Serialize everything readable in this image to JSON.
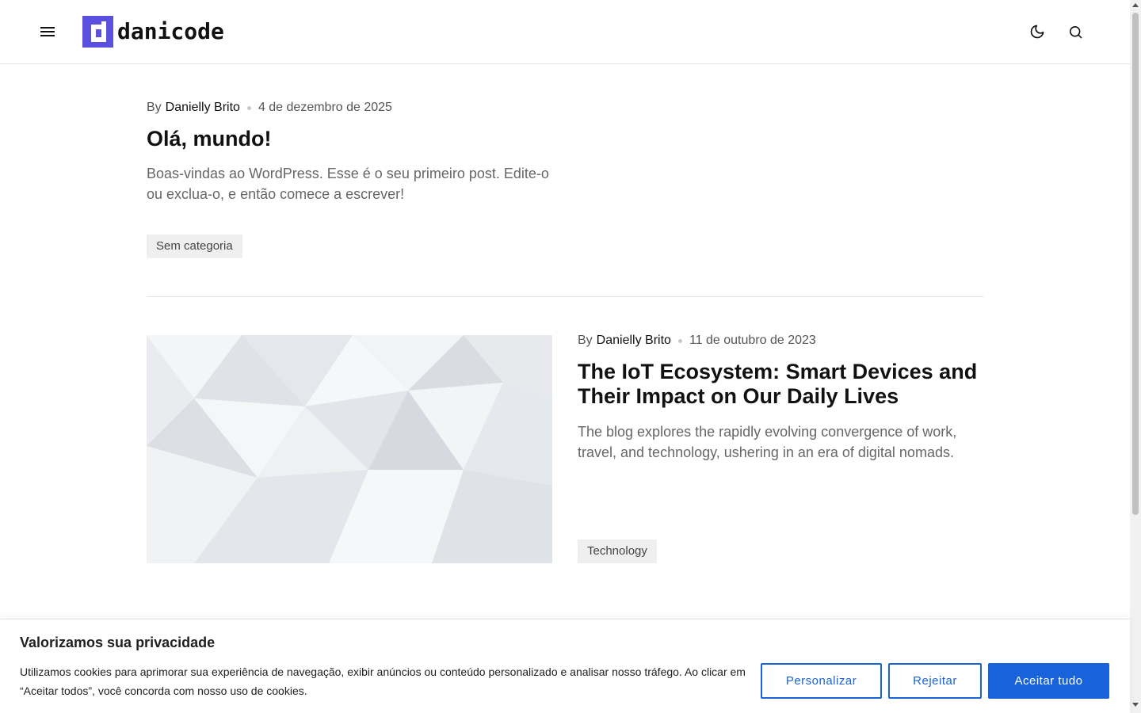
{
  "header": {
    "logo_text": "danicode",
    "accent_color": "#5b4fe0"
  },
  "posts": [
    {
      "by": "By",
      "author": "Danielly Brito",
      "date": "4 de dezembro de 2025",
      "title": "Olá, mundo!",
      "excerpt": "Boas-vindas ao WordPress. Esse é o seu primeiro post. Edite-o ou exclua-o, e então comece a escrever!",
      "tag": "Sem categoria"
    },
    {
      "by": "By",
      "author": "Danielly Brito",
      "date": "11 de outubro de 2023",
      "title": "The IoT Ecosystem: Smart Devices and Their Impact on Our Daily Lives",
      "excerpt": "The blog explores the rapidly evolving convergence of work, travel, and technology, ushering in an era of digital nomads.",
      "tag": "Technology",
      "image": "abstract-white-geometric-image"
    }
  ],
  "cookie_banner": {
    "title": "Valorizamos sua privacidade",
    "text": "Utilizamos cookies para aprimorar sua experiência de navegação, exibir anúncios ou conteúdo personalizado e analisar nosso tráfego. Ao clicar em “Aceitar todos”, você concorda com nosso uso de cookies.",
    "customize_label": "Personalizar",
    "reject_label": "Rejeitar",
    "accept_label": "Aceitar tudo",
    "button_color": "#1863dc"
  },
  "icons": {
    "menu": "hamburger-menu-icon",
    "theme": "moon-icon",
    "search": "search-icon"
  }
}
